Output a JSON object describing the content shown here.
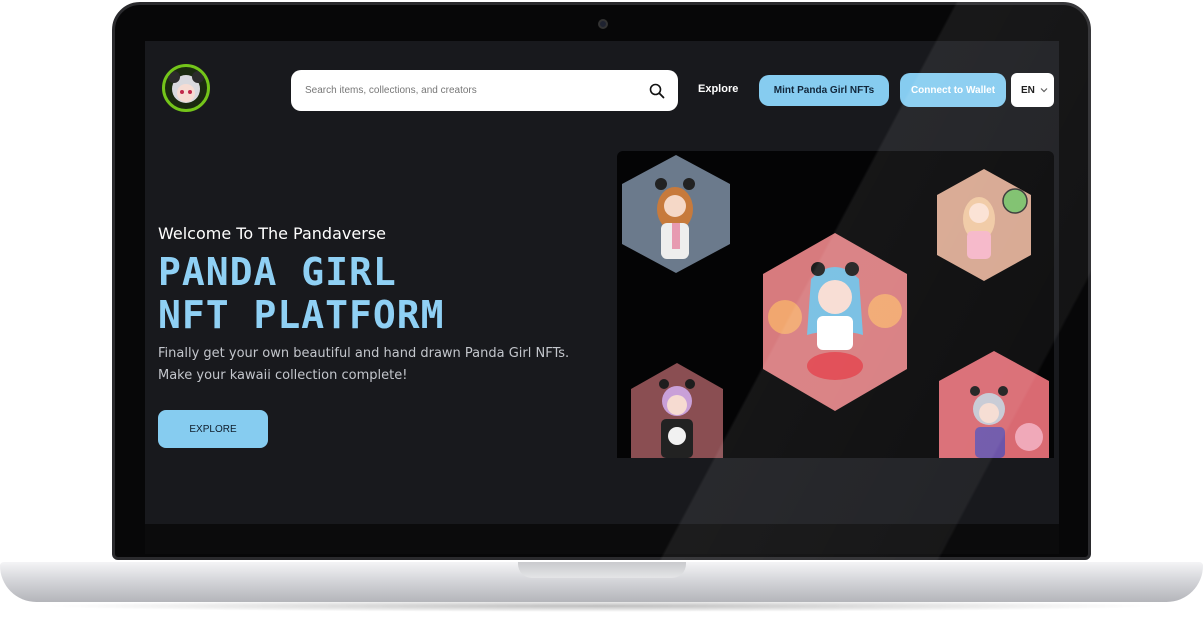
{
  "header": {
    "search": {
      "placeholder": "Search items, collections, and creators",
      "icon": "search-icon"
    },
    "nav_explore": "Explore",
    "mint_button": "Mint Panda Girl NFTs",
    "connect_button": "Connect to Wallet",
    "language": "EN"
  },
  "hero": {
    "welcome": "Welcome To The Pandaverse",
    "title_line1": "PANDA GIRL",
    "title_line2": "NFT PLATFORM",
    "description_line1": "Finally get your own beautiful and hand drawn Panda Girl NFTs.",
    "description_line2": "Make your kawaii collection complete!",
    "cta": "EXPLORE"
  },
  "colors": {
    "accent": "#86ccf0",
    "title": "#8fd0f4",
    "background": "#18191d"
  }
}
